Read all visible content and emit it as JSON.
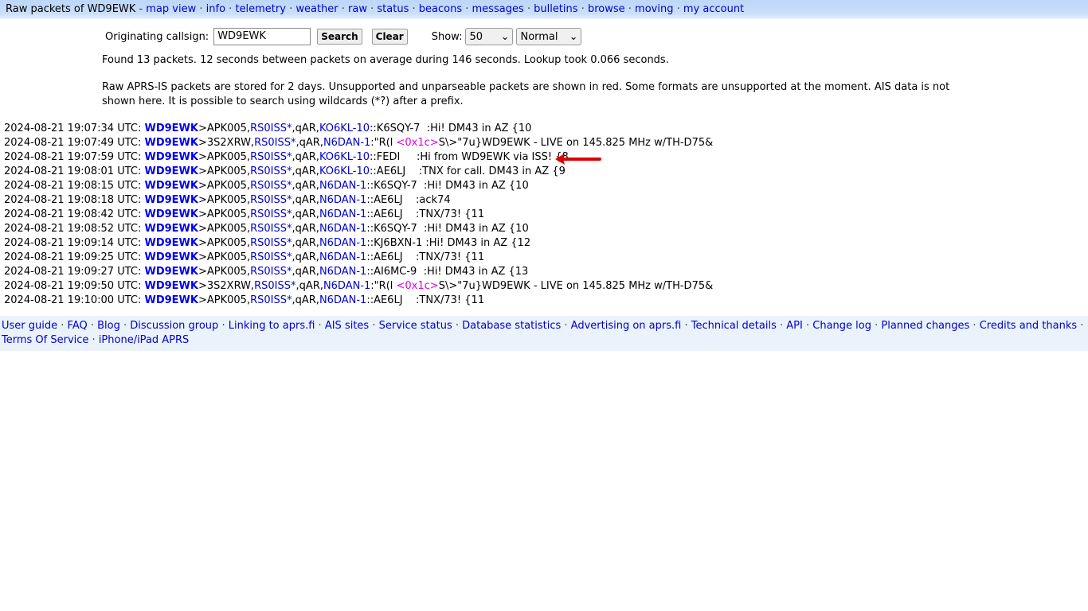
{
  "nav": {
    "title": "Raw packets of WD9EWK",
    "links": [
      "map view",
      "info",
      "telemetry",
      "weather",
      "raw",
      "status",
      "beacons",
      "messages",
      "bulletins",
      "browse",
      "moving",
      "my account"
    ]
  },
  "form": {
    "label": "Originating callsign:",
    "callsign": "WD9EWK",
    "search": "Search",
    "clear": "Clear",
    "show_label": "Show:",
    "count": "50",
    "mode": "Normal"
  },
  "summary": "Found 13 packets. 12 seconds between packets on average during 146 seconds. Lookup took 0.066 seconds.",
  "notice": "Raw APRS-IS packets are stored for 2 days. Unsupported and unparseable packets are shown in red. Some formats are unsupported at the moment. AIS data is not shown here. It is possible to search using wildcards (*?) after a prefix.",
  "packets": [
    {
      "time": "2024-08-21 19:07:34 UTC:",
      "call": "WD9EWK",
      "dest": ">APK005,",
      "digi": "RS0ISS*",
      "q": ",qAR,",
      "igate": "KO6KL-10",
      "pre": "::K6SQY-7  :Hi! DM43 in AZ {10",
      "hex": "",
      "post": ""
    },
    {
      "time": "2024-08-21 19:07:49 UTC:",
      "call": "WD9EWK",
      "dest": ">3S2XRW,",
      "digi": "RS0ISS*",
      "q": ",qAR,",
      "igate": "N6DAN-1",
      "pre": ":\"R(l ",
      "hex": "<0x1c>",
      "post": "S\\>\"7u}WD9EWK - LIVE on 145.825 MHz w/TH-D75&"
    },
    {
      "time": "2024-08-21 19:07:59 UTC:",
      "call": "WD9EWK",
      "dest": ">APK005,",
      "digi": "RS0ISS*",
      "q": ",qAR,",
      "igate": "KO6KL-10",
      "pre": "::FEDI     :Hi from WD9EWK via ISS! {8",
      "hex": "",
      "post": ""
    },
    {
      "time": "2024-08-21 19:08:01 UTC:",
      "call": "WD9EWK",
      "dest": ">APK005,",
      "digi": "RS0ISS*",
      "q": ",qAR,",
      "igate": "KO6KL-10",
      "pre": "::AE6LJ    :TNX for call. DM43 in AZ {9",
      "hex": "",
      "post": ""
    },
    {
      "time": "2024-08-21 19:08:15 UTC:",
      "call": "WD9EWK",
      "dest": ">APK005,",
      "digi": "RS0ISS*",
      "q": ",qAR,",
      "igate": "N6DAN-1",
      "pre": "::K6SQY-7  :Hi! DM43 in AZ {10",
      "hex": "",
      "post": ""
    },
    {
      "time": "2024-08-21 19:08:18 UTC:",
      "call": "WD9EWK",
      "dest": ">APK005,",
      "digi": "RS0ISS*",
      "q": ",qAR,",
      "igate": "N6DAN-1",
      "pre": "::AE6LJ    :ack74",
      "hex": "",
      "post": ""
    },
    {
      "time": "2024-08-21 19:08:42 UTC:",
      "call": "WD9EWK",
      "dest": ">APK005,",
      "digi": "RS0ISS*",
      "q": ",qAR,",
      "igate": "N6DAN-1",
      "pre": "::AE6LJ    :TNX/73! {11",
      "hex": "",
      "post": ""
    },
    {
      "time": "2024-08-21 19:08:52 UTC:",
      "call": "WD9EWK",
      "dest": ">APK005,",
      "digi": "RS0ISS*",
      "q": ",qAR,",
      "igate": "N6DAN-1",
      "pre": "::K6SQY-7  :Hi! DM43 in AZ {10",
      "hex": "",
      "post": ""
    },
    {
      "time": "2024-08-21 19:09:14 UTC:",
      "call": "WD9EWK",
      "dest": ">APK005,",
      "digi": "RS0ISS*",
      "q": ",qAR,",
      "igate": "N6DAN-1",
      "pre": "::KJ6BXN-1 :Hi! DM43 in AZ {12",
      "hex": "",
      "post": ""
    },
    {
      "time": "2024-08-21 19:09:25 UTC:",
      "call": "WD9EWK",
      "dest": ">APK005,",
      "digi": "RS0ISS*",
      "q": ",qAR,",
      "igate": "N6DAN-1",
      "pre": "::AE6LJ    :TNX/73! {11",
      "hex": "",
      "post": ""
    },
    {
      "time": "2024-08-21 19:09:27 UTC:",
      "call": "WD9EWK",
      "dest": ">APK005,",
      "digi": "RS0ISS*",
      "q": ",qAR,",
      "igate": "N6DAN-1",
      "pre": "::AI6MC-9  :Hi! DM43 in AZ {13",
      "hex": "",
      "post": ""
    },
    {
      "time": "2024-08-21 19:09:50 UTC:",
      "call": "WD9EWK",
      "dest": ">3S2XRW,",
      "digi": "RS0ISS*",
      "q": ",qAR,",
      "igate": "N6DAN-1",
      "pre": ":\"R(l ",
      "hex": "<0x1c>",
      "post": "S\\>\"7u}WD9EWK - LIVE on 145.825 MHz w/TH-D75&"
    },
    {
      "time": "2024-08-21 19:10:00 UTC:",
      "call": "WD9EWK",
      "dest": ">APK005,",
      "digi": "RS0ISS*",
      "q": ",qAR,",
      "igate": "N6DAN-1",
      "pre": "::AE6LJ    :TNX/73! {11",
      "hex": "",
      "post": ""
    }
  ],
  "footer": [
    "User guide",
    "FAQ",
    "Blog",
    "Discussion group",
    "Linking to aprs.fi",
    "AIS sites",
    "Service status",
    "Database statistics",
    "Advertising on aprs.fi",
    "Technical details",
    "API",
    "Change log",
    "Planned changes",
    "Credits and thanks",
    "Terms Of Service",
    "iPhone/iPad APRS"
  ],
  "colors": {
    "link": "#0000cc",
    "hex": "#e000e0",
    "arrow": "#dd0000"
  }
}
